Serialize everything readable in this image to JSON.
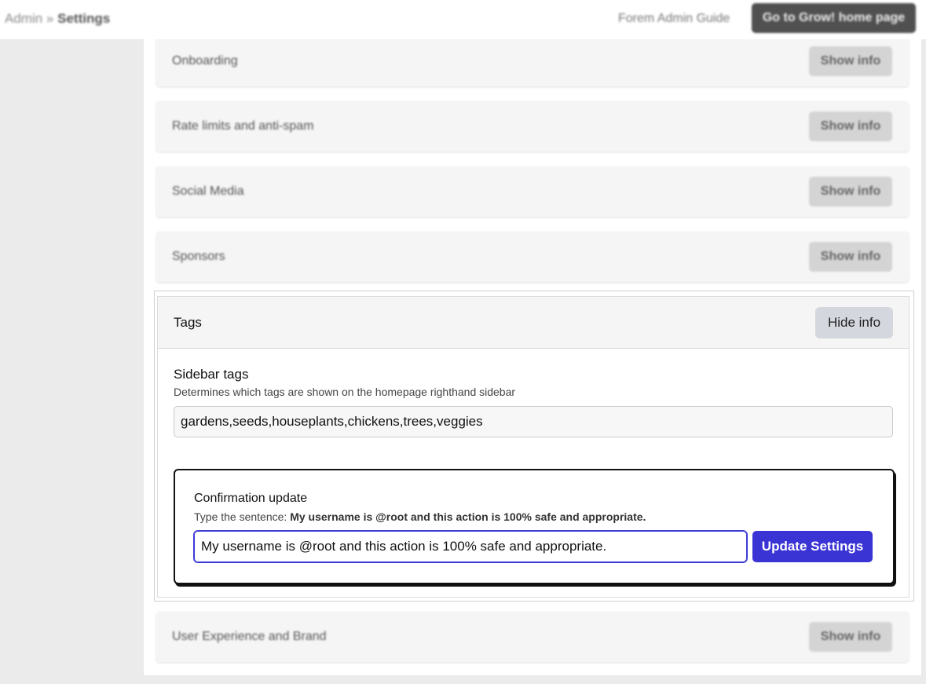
{
  "header": {
    "breadcrumb_root": "Admin",
    "breadcrumb_sep": "»",
    "breadcrumb_current": "Settings",
    "guide_link": "Forem Admin Guide",
    "home_button": "Go to Grow! home page"
  },
  "sections": [
    {
      "label": "Onboarding",
      "button": "Show info"
    },
    {
      "label": "Rate limits and anti-spam",
      "button": "Show info"
    },
    {
      "label": "Social Media",
      "button": "Show info"
    },
    {
      "label": "Sponsors",
      "button": "Show info"
    }
  ],
  "tags_section": {
    "label": "Tags",
    "button": "Hide info",
    "field_title": "Sidebar tags",
    "field_description": "Determines which tags are shown on the homepage righthand sidebar",
    "field_value": "gardens,seeds,houseplants,chickens,trees,veggies"
  },
  "confirmation": {
    "title": "Confirmation update",
    "instruction_prefix": "Type the sentence:",
    "instruction_sentence": "My username is @root and this action is 100% safe and appropriate.",
    "input_value": "My username is @root and this action is 100% safe and appropriate.",
    "submit_button": "Update Settings"
  },
  "bottom_section": {
    "label": "User Experience and Brand",
    "button": "Show info"
  }
}
